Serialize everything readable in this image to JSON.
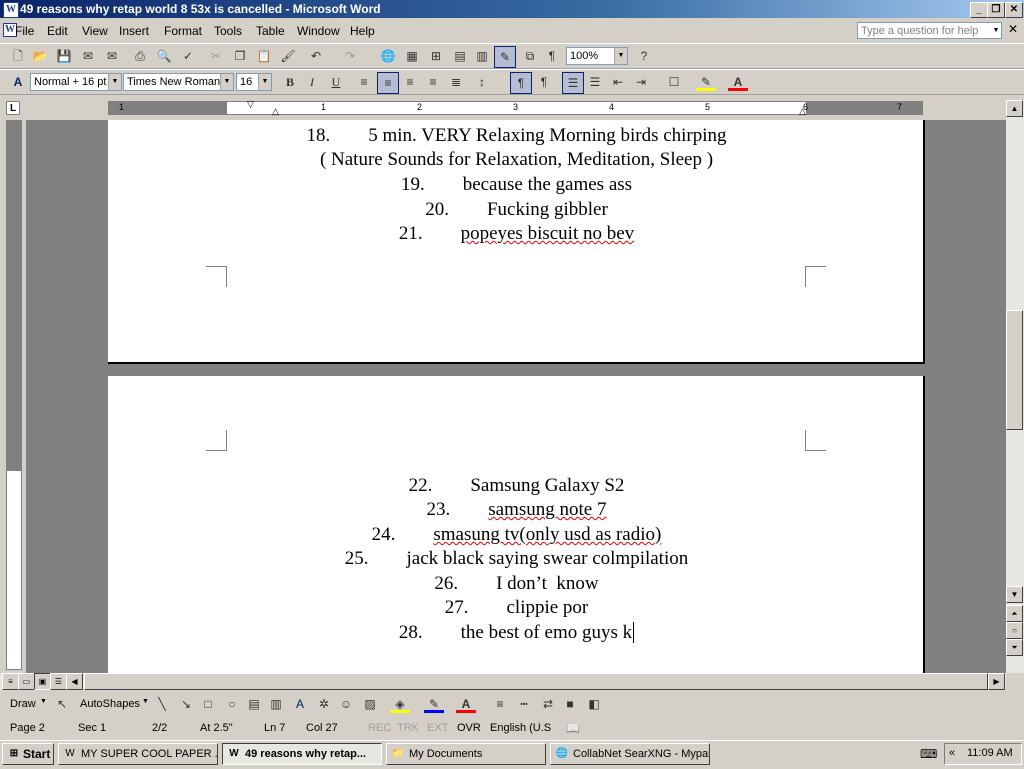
{
  "window": {
    "title": "49  reasons why retap world 8 53x is cancelled - Microsoft Word"
  },
  "menu": [
    "File",
    "Edit",
    "View",
    "Insert",
    "Format",
    "Tools",
    "Table",
    "Window",
    "Help"
  ],
  "help_box": {
    "placeholder": "Type a question for help"
  },
  "standard_toolbar": {
    "zoom": "100%"
  },
  "formatting_toolbar": {
    "style": "Normal + 16 pt",
    "font": "Times New Roman",
    "size": "16"
  },
  "ruler": {
    "numbers": [
      "1",
      "1",
      "2",
      "3",
      "4",
      "5",
      "6",
      "7"
    ]
  },
  "document": {
    "page1_lines": [
      {
        "num": "18.",
        "text": "5 min. VERY Relaxing Morning birds chirping"
      },
      {
        "num": "",
        "text": "( Nature Sounds for Relaxation, Meditation, Sleep )"
      },
      {
        "num": "19.",
        "text": "because the games ass"
      },
      {
        "num": "20.",
        "text": "Fucking gibbler"
      },
      {
        "num": "21.",
        "text": "popeyes biscuit no bev"
      }
    ],
    "page2_lines": [
      {
        "num": "22.",
        "text": "Samsung Galaxy S2"
      },
      {
        "num": "23.",
        "text": "samsung note 7"
      },
      {
        "num": "24.",
        "text": "smasung tv(only usd as radio)"
      },
      {
        "num": "25.",
        "text": "jack black saying swear colmpilation"
      },
      {
        "num": "26.",
        "text": "I don’t  know"
      },
      {
        "num": "27.",
        "text": "clippie por"
      },
      {
        "num": "28.",
        "text": "the best of emo guys k"
      }
    ]
  },
  "draw_toolbar": {
    "draw_label": "Draw",
    "autoshapes_label": "AutoShapes"
  },
  "status": {
    "page": "Page  2",
    "sec": "Sec  1",
    "pages": "2/2",
    "at": "At  2.5\"",
    "ln": "Ln  7",
    "col": "Col  27",
    "rec": "REC",
    "trk": "TRK",
    "ext": "EXT",
    "ovr": "OVR",
    "lang": "English (U.S"
  },
  "taskbar": {
    "start": "Start",
    "tasks": [
      "MY SUPER COOL PAPER ...",
      "49  reasons why retap...",
      "My Documents",
      "CollabNet SearXNG - Mypal"
    ],
    "clock": "11:09 AM"
  }
}
